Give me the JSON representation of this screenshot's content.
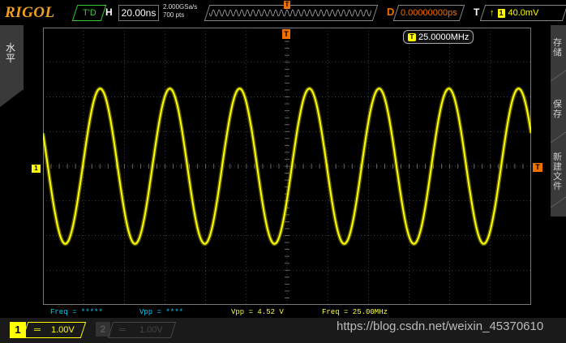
{
  "brand": "RIGOL",
  "top": {
    "run_state": "T'D",
    "h_label": "H",
    "timebase": "20.00ns",
    "sample_rate": "2.000GSa/s",
    "memory_depth": "700 pts",
    "mem_trigger_marker": "T",
    "delay_label": "D",
    "delay_value": "0.00000000ps",
    "trigger_label": "T",
    "trigger_edge_icon": "rising-edge-icon",
    "trigger_source": "1",
    "trigger_level": "40.0mV"
  },
  "left_tab": {
    "text": "水平"
  },
  "right_tabs": [
    "存储",
    "保存",
    "新建文件"
  ],
  "markers": {
    "ch1": "1",
    "trigger_top": "T",
    "trigger_right": "T"
  },
  "freq_counter": {
    "channel": "T",
    "value": "25.0000MHz"
  },
  "measurements": {
    "freq1": "Freq = *****",
    "vpp1": "Vpp = ****",
    "vpp2": "Vpp = 4.52 V",
    "freq2": "Freq = 25.00MHz"
  },
  "channels": {
    "ch1": {
      "label": "1",
      "coupling_icon": "dc-coupling-icon",
      "scale": "1.00V"
    },
    "ch2": {
      "label": "2",
      "coupling_icon": "dc-coupling-icon",
      "scale": "1.00V"
    }
  },
  "waveform": {
    "color": "#ffff00",
    "cycles_on_screen": 7,
    "vpp_fraction_of_height": 0.56
  },
  "watermark": "https://blog.csdn.net/weixin_45370610",
  "colors": {
    "brand": "#f0a020",
    "ch1": "#ffff00",
    "trigger": "#f07000",
    "accent_green": "#33cc33",
    "meas_cyan": "#00d0ff"
  }
}
